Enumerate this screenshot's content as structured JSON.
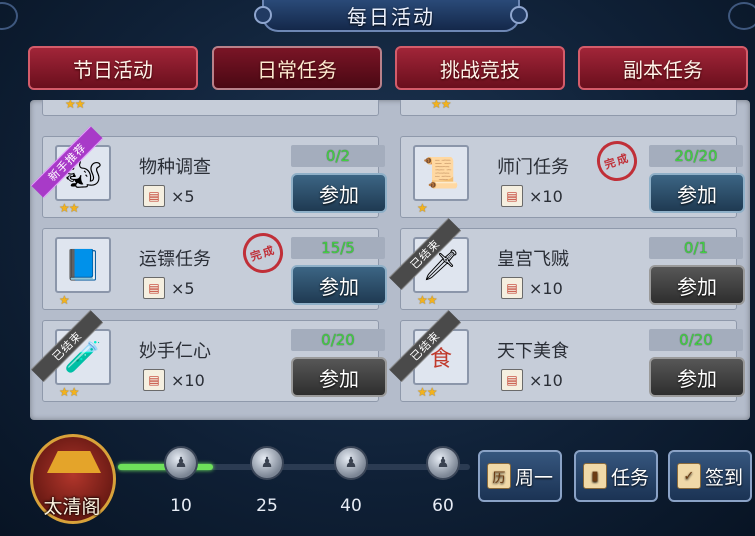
{
  "window": {
    "title": "每日活动"
  },
  "tabs": [
    {
      "label": "节日活动",
      "active": false
    },
    {
      "label": "日常任务",
      "active": true
    },
    {
      "label": "挑战竞技",
      "active": false
    },
    {
      "label": "副本任务",
      "active": false
    }
  ],
  "tasks": [
    {
      "name": "物种调查",
      "progress": "0/2",
      "reward_count": "×5",
      "stars": "★★",
      "button": "参加",
      "state": "available",
      "ribbon": "新手推荐",
      "icon": "acorn-monster-icon"
    },
    {
      "name": "师门任务",
      "progress": "20/20",
      "reward_count": "×10",
      "stars": "★",
      "button": "参加",
      "state": "completed",
      "stamp": "完成",
      "icon": "scroll-icon"
    },
    {
      "name": "运镖任务",
      "progress": "15/5",
      "reward_count": "×5",
      "stars": "★",
      "button": "参加",
      "state": "completed",
      "stamp": "完成",
      "icon": "book-icon"
    },
    {
      "name": "皇宫飞贼",
      "progress": "0/1",
      "reward_count": "×10",
      "stars": "★★",
      "button": "参加",
      "state": "ended",
      "ribbon": "已结束",
      "icon": "dart-icon"
    },
    {
      "name": "妙手仁心",
      "progress": "0/20",
      "reward_count": "×10",
      "stars": "★★",
      "button": "参加",
      "state": "ended",
      "ribbon": "已结束",
      "icon": "medicine-icon"
    },
    {
      "name": "天下美食",
      "progress": "0/20",
      "reward_count": "×10",
      "stars": "★★",
      "button": "参加",
      "state": "ended",
      "ribbon": "已结束",
      "icon": "food-icon"
    }
  ],
  "activity": {
    "hall_label": "太清阁",
    "progress_fraction": 0.27,
    "milestones": [
      "10",
      "25",
      "40",
      "60"
    ]
  },
  "bottom_buttons": {
    "week": {
      "icon_text": "历",
      "label": "周一"
    },
    "task": {
      "label": "任务"
    },
    "signin": {
      "label": "签到"
    }
  },
  "colors": {
    "tab_red": "#8a1a2b",
    "progress_green": "#43d043",
    "join_button": "#2c4e6c",
    "ended_button": "#444444",
    "stamp_red": "#c0141c"
  }
}
